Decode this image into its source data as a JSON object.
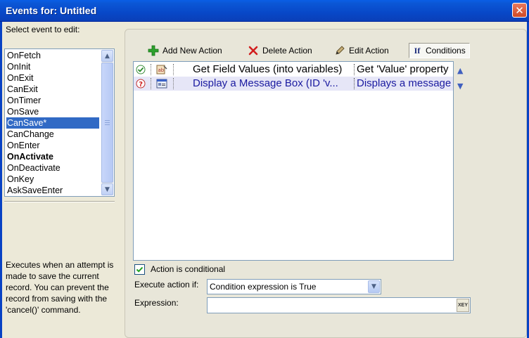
{
  "window": {
    "title": "Events for:  Untitled",
    "close_glyph": "✕"
  },
  "events": {
    "label": "Select event to edit:",
    "items": [
      {
        "label": "OnFetch",
        "bold": false,
        "selected": false
      },
      {
        "label": "OnInit",
        "bold": false,
        "selected": false
      },
      {
        "label": "OnExit",
        "bold": false,
        "selected": false
      },
      {
        "label": "CanExit",
        "bold": false,
        "selected": false
      },
      {
        "label": "OnTimer",
        "bold": false,
        "selected": false
      },
      {
        "label": "OnSave",
        "bold": false,
        "selected": false
      },
      {
        "label": "CanSave*",
        "bold": false,
        "selected": true
      },
      {
        "label": "CanChange",
        "bold": false,
        "selected": false
      },
      {
        "label": "OnEnter",
        "bold": false,
        "selected": false
      },
      {
        "label": "OnActivate",
        "bold": true,
        "selected": false
      },
      {
        "label": "OnDeactivate",
        "bold": false,
        "selected": false
      },
      {
        "label": "OnKey",
        "bold": false,
        "selected": false
      },
      {
        "label": "AskSaveEnter",
        "bold": false,
        "selected": false
      }
    ],
    "description": "Executes when an attempt is made to save the current record. You can prevent the record from saving with the 'cancel()' command."
  },
  "toolbar": {
    "add_label": "Add New Action",
    "delete_label": "Delete Action",
    "edit_label": "Edit Action",
    "conditions_label": "Conditions",
    "conditions_icon_text": "If"
  },
  "actions": {
    "rows": [
      {
        "status": "check",
        "name": "Get Field Values (into variables)",
        "description": "Get 'Value' property",
        "selected": false
      },
      {
        "status": "question",
        "name": "Display a Message Box (ID 'v...",
        "description": "Displays a message",
        "selected": true
      }
    ]
  },
  "condition": {
    "checkbox_label": "Action is conditional",
    "checked": true,
    "execute_label": "Execute action if:",
    "execute_value": "Condition expression is True",
    "expression_label": "Expression:",
    "expression_value": "",
    "expression_button_text": "XEY"
  },
  "colors": {
    "title_bar": "#0A4FD6",
    "selection": "#316AC5",
    "dialog_bg": "#ECE9D8"
  }
}
